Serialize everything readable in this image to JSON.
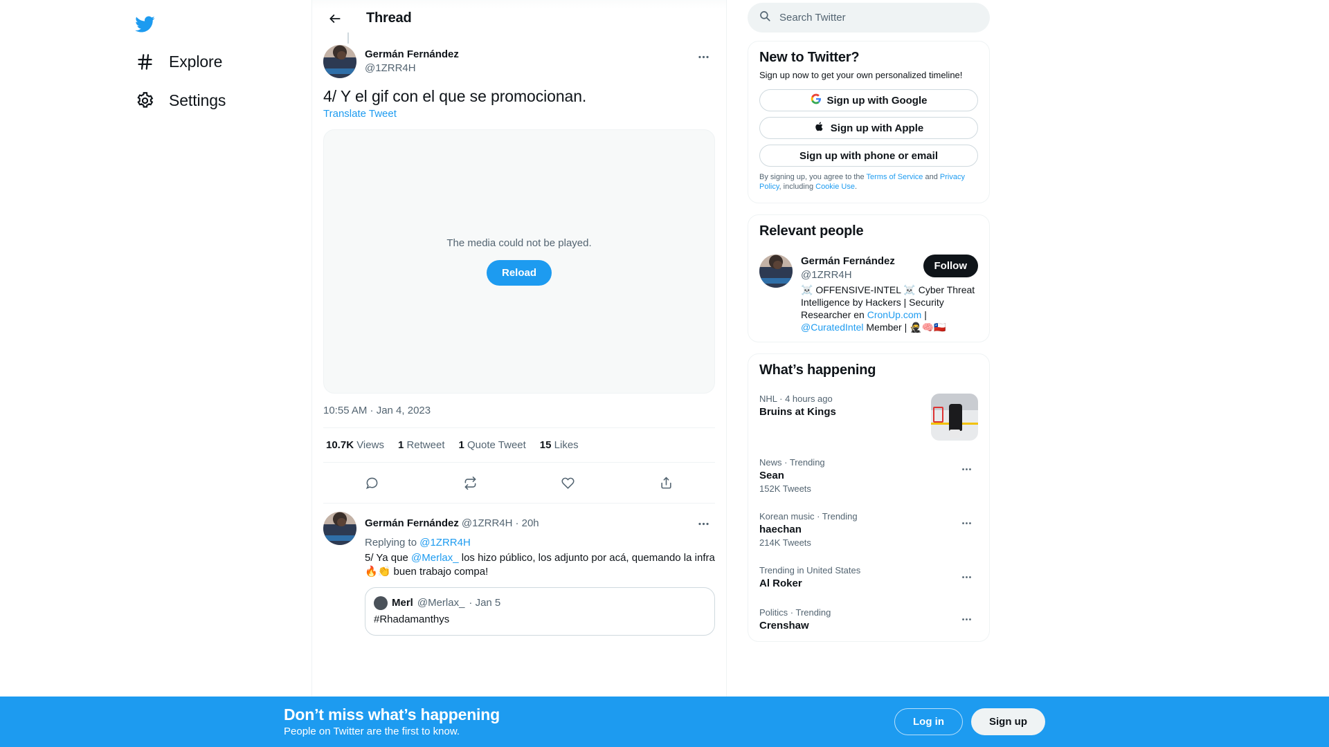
{
  "sidebar": {
    "logo": "twitter-bird-logo",
    "items": [
      {
        "icon": "hashtag-icon",
        "label": "Explore"
      },
      {
        "icon": "gear-icon",
        "label": "Settings"
      }
    ]
  },
  "thread": {
    "header_title": "Thread",
    "back_icon": "back-arrow-icon",
    "main_tweet": {
      "display_name": "Germán Fernández",
      "handle": "@1ZRR4H",
      "text": "4/ Y el gif con el que se promocionan.",
      "translate_label": "Translate Tweet",
      "more_icon": "more-options-icon",
      "media": {
        "error_text": "The media could not be played.",
        "reload_label": "Reload"
      },
      "timestamp": "10:55 AM · Jan 4, 2023",
      "metrics": [
        {
          "value": "10.7K",
          "label": "Views"
        },
        {
          "value": "1",
          "label": "Retweet"
        },
        {
          "value": "1",
          "label": "Quote Tweet"
        },
        {
          "value": "15",
          "label": "Likes"
        }
      ],
      "actions": [
        {
          "icon": "reply-icon",
          "name": "reply-button"
        },
        {
          "icon": "retweet-icon",
          "name": "retweet-button"
        },
        {
          "icon": "like-heart-icon",
          "name": "like-button"
        },
        {
          "icon": "share-icon",
          "name": "share-button"
        }
      ]
    },
    "reply_tweet": {
      "display_name": "Germán Fernández",
      "handle": "@1ZRR4H",
      "time": "· 20h",
      "replying_prefix": "Replying to ",
      "replying_to": "@1ZRR4H",
      "text_part1": "5/ Ya que ",
      "mention": "@Merlax_",
      "text_part2": " los hizo público, los adjunto por acá, quemando la infra 🔥👏 buen trabajo compa!",
      "more_icon": "more-options-icon",
      "quote": {
        "display_name": "Merl",
        "handle": "@Merlax_",
        "time": "· Jan 5",
        "text": "#Rhadamanthys"
      }
    }
  },
  "search": {
    "placeholder": "Search Twitter",
    "icon": "search-icon",
    "value": ""
  },
  "signup_card": {
    "title": "New to Twitter?",
    "subtitle": "Sign up now to get your own personalized timeline!",
    "buttons": [
      {
        "icon": "google-icon",
        "label": "Sign up with Google"
      },
      {
        "icon": "apple-icon",
        "label": "Sign up with Apple"
      },
      {
        "icon": "",
        "label": "Sign up with phone or email"
      }
    ],
    "legal_prefix": "By signing up, you agree to the ",
    "legal_terms": "Terms of Service",
    "legal_and": " and ",
    "legal_privacy": "Privacy Policy",
    "legal_including": ", including ",
    "legal_cookie": "Cookie Use",
    "legal_end": "."
  },
  "relevant_people": {
    "title": "Relevant people",
    "person": {
      "display_name": "Germán Fernández",
      "handle": "@1ZRR4H",
      "follow_label": "Follow",
      "bio_emoji1": "☠️",
      "bio_part1": " OFFENSIVE-INTEL ",
      "bio_emoji2": "☠️",
      "bio_part2": " Cyber Threat Intelligence by Hackers | Security Researcher en ",
      "bio_link1": "CronUp.com",
      "bio_part3": " | ",
      "bio_link2": "@CuratedIntel",
      "bio_part4": " Member | 🥷🧠🇨🇱"
    }
  },
  "whats_happening": {
    "title": "What’s happening",
    "items": [
      {
        "category": "NHL · 4 hours ago",
        "name": "Bruins at Kings",
        "count": "",
        "has_thumb": true,
        "has_more": false
      },
      {
        "category": "News · Trending",
        "name": "Sean",
        "count": "152K Tweets",
        "has_thumb": false,
        "has_more": true
      },
      {
        "category": "Korean music · Trending",
        "name": "haechan",
        "count": "214K Tweets",
        "has_thumb": false,
        "has_more": true
      },
      {
        "category": "Trending in United States",
        "name": "Al Roker",
        "count": "",
        "has_thumb": false,
        "has_more": true
      },
      {
        "category": "Politics · Trending",
        "name": "Crenshaw",
        "count": "",
        "has_thumb": false,
        "has_more": true
      }
    ]
  },
  "bottom_banner": {
    "title": "Don’t miss what’s happening",
    "subtitle": "People on Twitter are the first to know.",
    "login_label": "Log in",
    "signup_label": "Sign up"
  },
  "colors": {
    "accent": "#1d9bf0",
    "text": "#0f1419",
    "muted": "#536471",
    "border": "#eff3f4"
  }
}
